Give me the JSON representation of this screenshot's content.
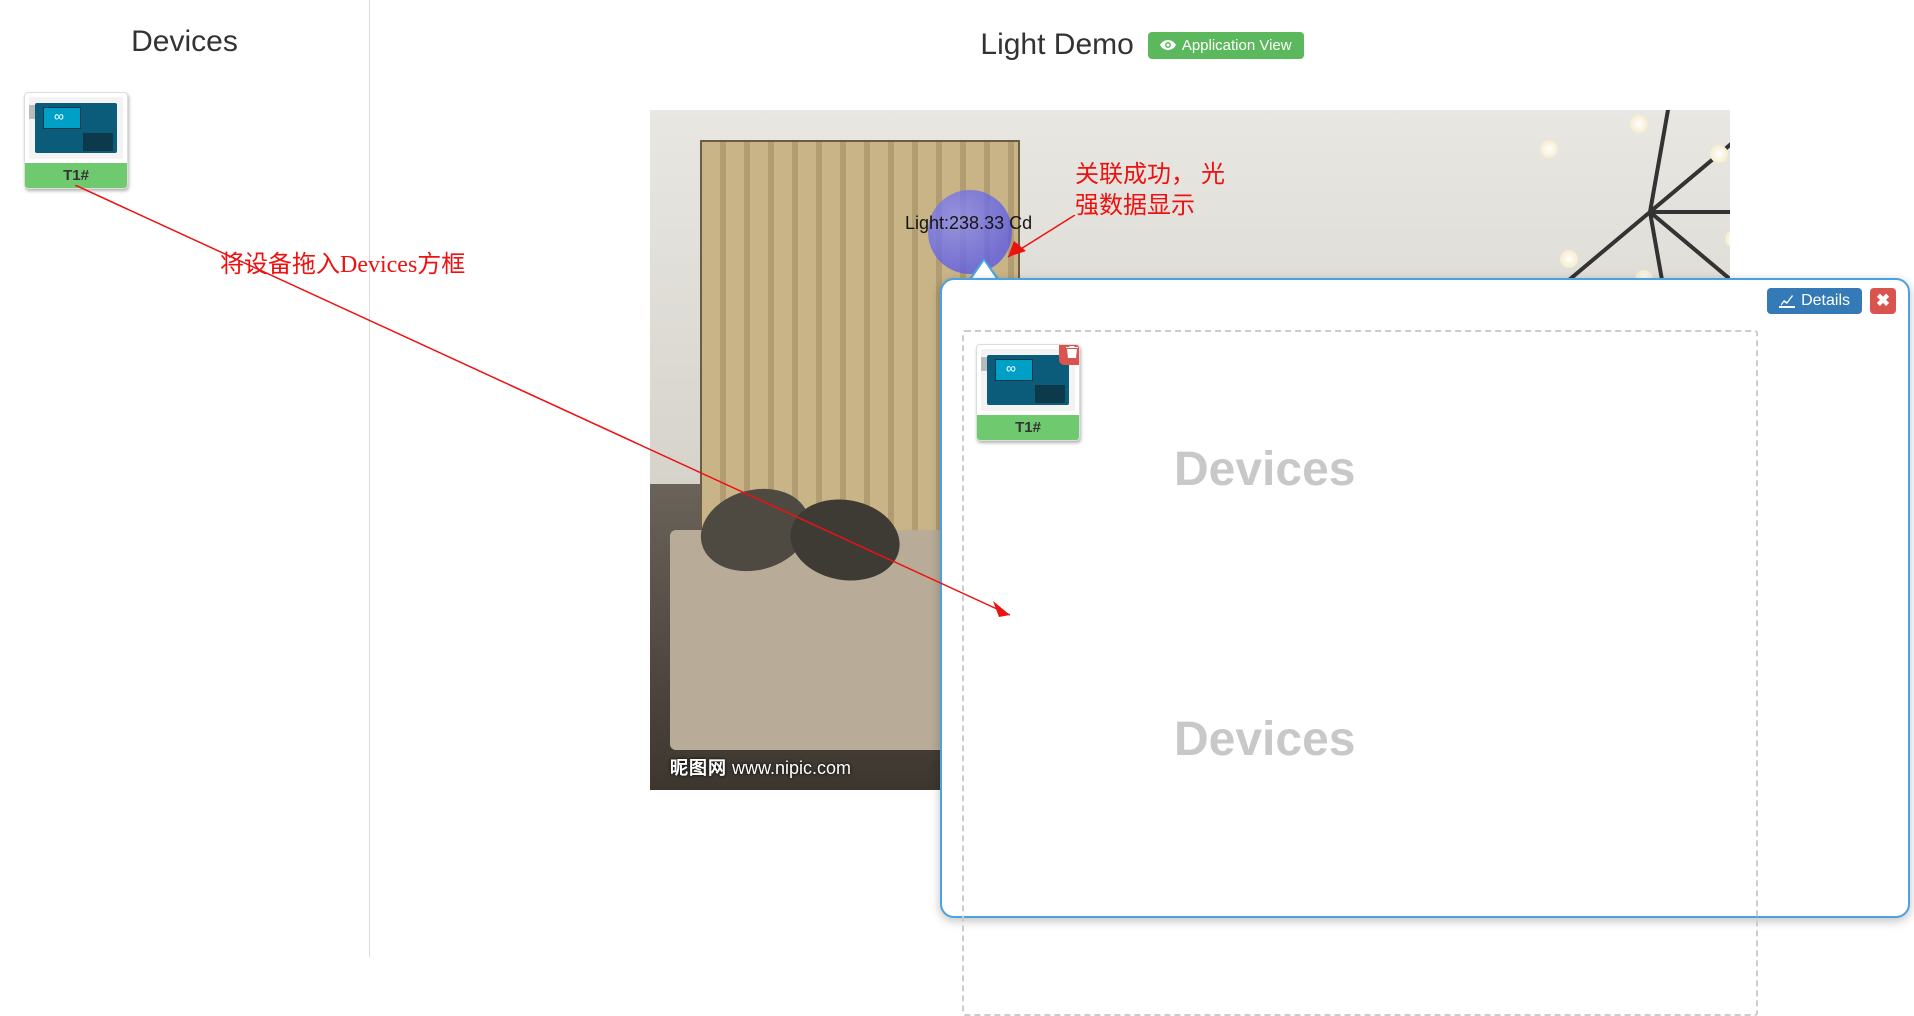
{
  "sidebar": {
    "title": "Devices",
    "device": {
      "label": "T1#"
    }
  },
  "main": {
    "title": "Light Demo",
    "app_view_label": "Application View"
  },
  "sensor": {
    "label": "Light:238.33 Cd"
  },
  "popup": {
    "details_label": "Details",
    "dropzone_label_1": "Devices",
    "dropzone_label_2": "Devices",
    "device": {
      "label": "T1#"
    }
  },
  "room_watermark": {
    "cn": "昵图网",
    "url": "www.nipic.com"
  },
  "annotations": {
    "drag_hint": "将设备拖入Devices方框",
    "success_hint": "关联成功， 光\n强数据显示"
  }
}
